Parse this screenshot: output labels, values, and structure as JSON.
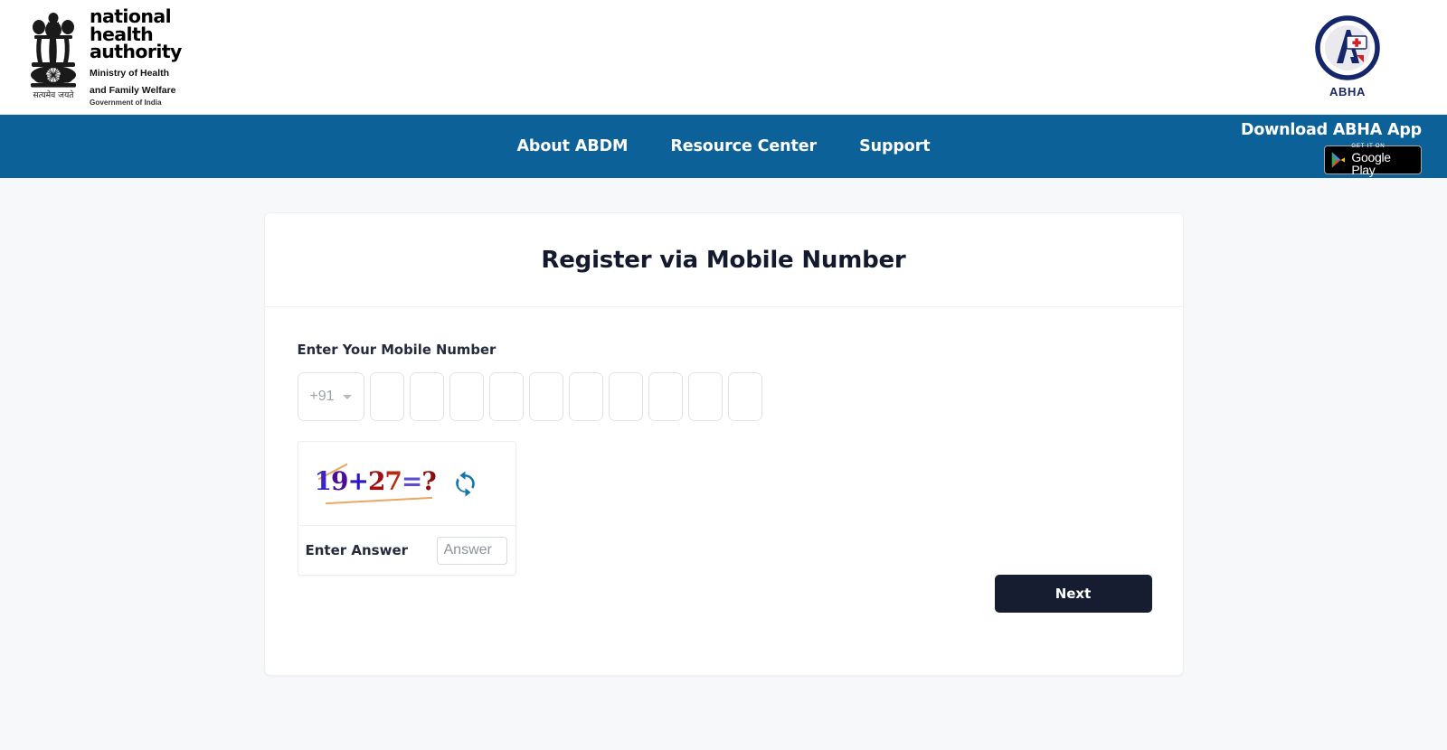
{
  "header": {
    "emblem_icon": "india-state-emblem-icon",
    "emblem_motto": "सत्यमेव जयते",
    "org_line1": "national",
    "org_line2": "health",
    "org_line3": "authority",
    "ministry_line1": "Ministry of Health",
    "ministry_line2": "and Family Welfare",
    "government_line": "Government of India",
    "abha_logo_label": "ABHA"
  },
  "nav": {
    "links": [
      {
        "label": "About ABDM"
      },
      {
        "label": "Resource Center"
      },
      {
        "label": "Support"
      }
    ],
    "download_title": "Download ABHA App",
    "play_badge_small": "GET IT ON",
    "play_badge_name": "Google Play",
    "bg_color": "#0d6199"
  },
  "card": {
    "title": "Register via Mobile Number",
    "mobile_label": "Enter Your Mobile Number",
    "country_code": "+91",
    "country_code_caret_icon": "chevron-down-icon",
    "digits": [
      "",
      "",
      "",
      "",
      "",
      "",
      "",
      "",
      "",
      ""
    ],
    "captcha": {
      "chars": [
        {
          "ch": "1",
          "cls": "cc1"
        },
        {
          "ch": "9",
          "cls": "cc2"
        },
        {
          "ch": "+",
          "cls": "cc3"
        },
        {
          "ch": "2",
          "cls": "cc4"
        },
        {
          "ch": "7",
          "cls": "cc5"
        },
        {
          "ch": "=",
          "cls": "cc6"
        },
        {
          "ch": "?",
          "cls": "cc7"
        }
      ],
      "expression": "19+27=?",
      "refresh_icon": "refresh-icon",
      "answer_label": "Enter Answer",
      "answer_value": "",
      "answer_placeholder": "Answer"
    },
    "next_label": "Next"
  },
  "colors": {
    "page_bg": "#f7f8fa",
    "nav_blue": "#0d6199",
    "next_btn": "#161d30",
    "abha_navy": "#1b2a63",
    "refresh_blue": "#1176ab"
  }
}
